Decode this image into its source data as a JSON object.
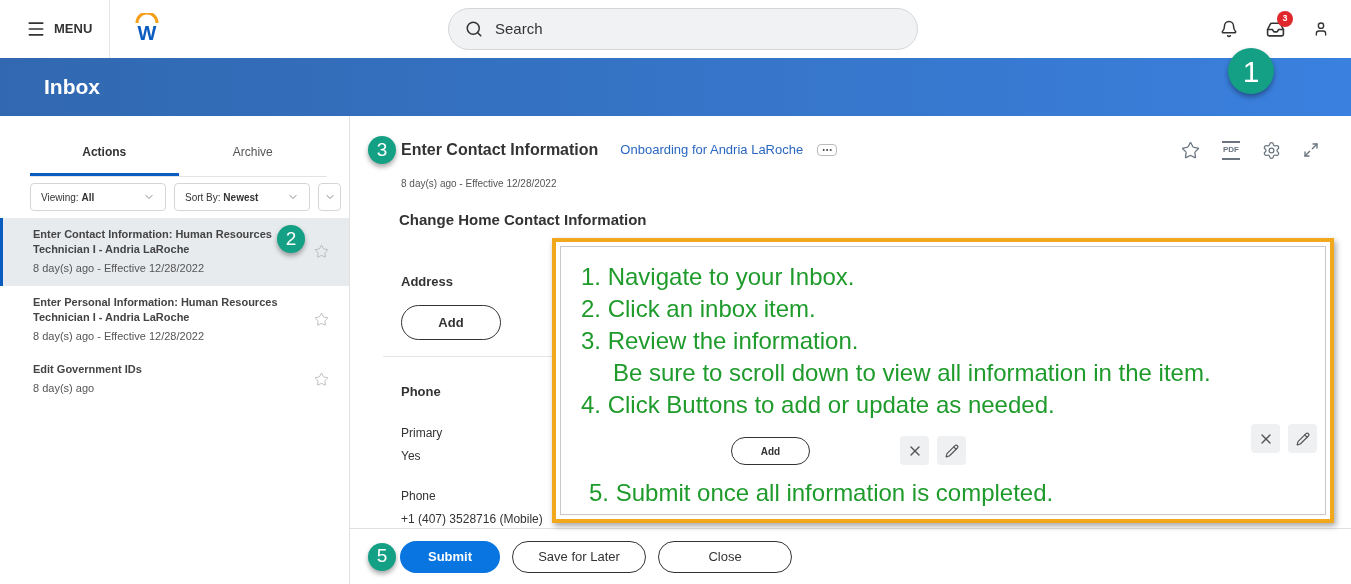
{
  "top_bar": {
    "menu_label": "MENU",
    "logo_letter": "W",
    "search": {
      "placeholder": "Search"
    },
    "inbox_badge": "3",
    "marker": "1"
  },
  "banner": {
    "title": "Inbox"
  },
  "tabs": [
    {
      "label": "Actions",
      "selected": true
    },
    {
      "label": "Archive",
      "selected": false
    }
  ],
  "filters": [
    {
      "label": "Viewing:",
      "value": "All"
    },
    {
      "label": "Sort By:",
      "value": "Newest"
    }
  ],
  "inbox_items": [
    {
      "title": "Enter Contact Information: Human Resources Technician I - Andria LaRoche",
      "meta": "8 day(s) ago - Effective 12/28/2022",
      "selected": true,
      "marker": "2"
    },
    {
      "title": "Enter Personal Information: Human Resources Technician I - Andria LaRoche",
      "meta": "8 day(s) ago - Effective 12/28/2022",
      "selected": false
    },
    {
      "title": "Edit Government IDs",
      "meta": "8 day(s) ago",
      "selected": false
    }
  ],
  "detail": {
    "marker": "3",
    "title": "Enter Contact Information",
    "link": "Onboarding for Andria LaRoche",
    "pdf_label": "PDF",
    "meta": "8 day(s) ago -  Effective 12/28/2022",
    "section": "Change Home Contact Information",
    "address": {
      "heading": "Address",
      "button": "Add"
    },
    "phone": {
      "heading": "Phone",
      "fields": [
        {
          "label": "Primary",
          "value": "Yes"
        },
        {
          "label": "Phone",
          "value": "+1 (407) 3528716 (Mobile)"
        }
      ]
    }
  },
  "footer": {
    "marker": "5",
    "buttons": [
      {
        "label": "Submit",
        "kind": "primary"
      },
      {
        "label": "Save for Later",
        "kind": "secondary"
      },
      {
        "label": "Close",
        "kind": "secondary"
      }
    ]
  },
  "callout": {
    "steps_top": [
      {
        "text": "1. Navigate to your Inbox.",
        "kind": "step"
      },
      {
        "text": "2. Click an inbox item.",
        "kind": "step"
      },
      {
        "text": "3. Review the information.",
        "kind": "step"
      },
      {
        "text": "Be sure to scroll down to view all information in the item.",
        "kind": "note"
      },
      {
        "text": "4. Click Buttons to add or update as needed.",
        "kind": "step"
      }
    ],
    "add_button": "Add",
    "steps_bottom": [
      {
        "text": "5. Submit once all information is completed.",
        "kind": "step"
      }
    ]
  }
}
